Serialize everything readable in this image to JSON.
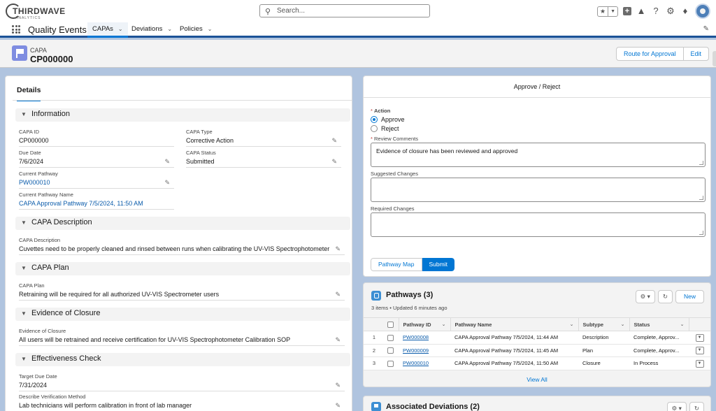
{
  "brand": {
    "logo_main": "THIRDWAVE",
    "logo_sub": "ANALYTICS"
  },
  "search": {
    "placeholder": "Search..."
  },
  "app": {
    "name": "Quality Events",
    "tabs": [
      {
        "label": "CAPAs",
        "active": true
      },
      {
        "label": "Deviations",
        "active": false
      },
      {
        "label": "Policies",
        "active": false
      }
    ]
  },
  "record": {
    "type": "CAPA",
    "name": "CP000000",
    "buttons": {
      "route": "Route for Approval",
      "edit": "Edit"
    }
  },
  "details": {
    "tab_label": "Details",
    "sections": {
      "information": "Information",
      "capa_description": "CAPA Description",
      "capa_plan": "CAPA Plan",
      "evidence": "Evidence of Closure",
      "effectiveness": "Effectiveness Check"
    },
    "fields": {
      "capa_id": {
        "label": "CAPA ID",
        "value": "CP000000"
      },
      "capa_type": {
        "label": "CAPA Type",
        "value": "Corrective Action"
      },
      "due_date": {
        "label": "Due Date",
        "value": "7/6/2024"
      },
      "capa_status": {
        "label": "CAPA Status",
        "value": "Submitted"
      },
      "current_pathway": {
        "label": "Current Pathway",
        "value": "PW000010"
      },
      "current_pathway_name": {
        "label": "Current Pathway Name",
        "value": "CAPA Approval Pathway 7/5/2024, 11:50 AM"
      },
      "capa_description": {
        "label": "CAPA Description",
        "value": "Cuvettes need to be properly cleaned and rinsed between runs when calibrating the UV-VIS Spectrophotometer"
      },
      "capa_plan": {
        "label": "CAPA Plan",
        "value": "Retraining will be required for all authorized UV-VIS Spectrometer users"
      },
      "evidence": {
        "label": "Evidence of Closure",
        "value": "All users will be retrained and receive certification for UV-VIS Spectrophotometer Calibration SOP"
      },
      "target_due_date": {
        "label": "Target Due Date",
        "value": "7/31/2024"
      },
      "verification_method": {
        "label": "Describe Verification Method",
        "value": "Lab technicians will perform calibration in front of lab manager"
      }
    }
  },
  "approve": {
    "title": "Approve / Reject",
    "required_mark": "*",
    "action_label": "Action",
    "options": {
      "approve": "Approve",
      "reject": "Reject"
    },
    "selected": "Approve",
    "review_label": "Review Comments",
    "review_value": "Evidence of closure has been reviewed and approved",
    "suggested_label": "Suggested Changes",
    "required_label": "Required Changes",
    "buttons": {
      "pathway_map": "Pathway Map",
      "submit": "Submit"
    }
  },
  "pathways": {
    "title": "Pathways (3)",
    "subtitle": "3 items • Updated 6 minutes ago",
    "new_label": "New",
    "columns": [
      "Pathway ID",
      "Pathway Name",
      "Subtype",
      "Status"
    ],
    "rows": [
      {
        "n": "1",
        "id": "PW000008",
        "name": "CAPA Approval Pathway 7/5/2024, 11:44 AM",
        "subtype": "Description",
        "status": "Complete, Approv..."
      },
      {
        "n": "2",
        "id": "PW000009",
        "name": "CAPA Approval Pathway 7/5/2024, 11:45 AM",
        "subtype": "Plan",
        "status": "Complete, Approv..."
      },
      {
        "n": "3",
        "id": "PW000010",
        "name": "CAPA Approval Pathway 7/5/2024, 11:50 AM",
        "subtype": "Closure",
        "status": "In Process"
      }
    ],
    "view_all": "View All"
  },
  "assoc_deviations": {
    "title": "Associated Deviations (2)"
  },
  "icons": {
    "search": "search-icon",
    "favorites": "star-icon",
    "add": "plus-icon",
    "help": "question-icon",
    "setup": "gear-icon",
    "notifications": "bell-icon"
  },
  "colors": {
    "brand_blue": "#0176d3",
    "nav_bar": "#1b5297",
    "record_icon": "#7f8de1",
    "page_bg": "#b0c4df"
  }
}
